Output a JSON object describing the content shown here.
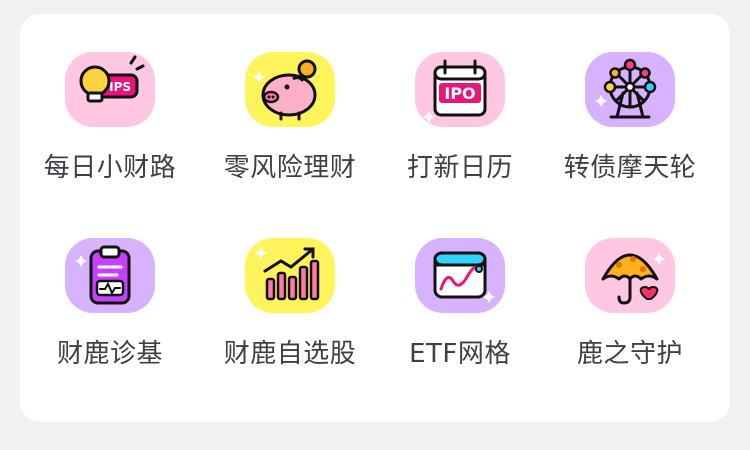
{
  "items": [
    {
      "label": "每日小财路",
      "icon": "lightbulb-tips-icon",
      "bg": "#ffc7e2"
    },
    {
      "label": "零风险理财",
      "icon": "piggy-bank-icon",
      "bg": "#fff45c"
    },
    {
      "label": "打新日历",
      "icon": "ipo-calendar-icon",
      "bg": "#ffc7e2"
    },
    {
      "label": "转债摩天轮",
      "icon": "ferris-wheel-icon",
      "bg": "#d7b2ff"
    },
    {
      "label": "财鹿诊基",
      "icon": "clipboard-diagnosis-icon",
      "bg": "#d7b2ff"
    },
    {
      "label": "财鹿自选股",
      "icon": "bar-chart-up-icon",
      "bg": "#fff45c"
    },
    {
      "label": "ETF网格",
      "icon": "line-chart-panel-icon",
      "bg": "#d7b2ff"
    },
    {
      "label": "鹿之守护",
      "icon": "umbrella-heart-icon",
      "bg": "#ffc7e2"
    }
  ]
}
